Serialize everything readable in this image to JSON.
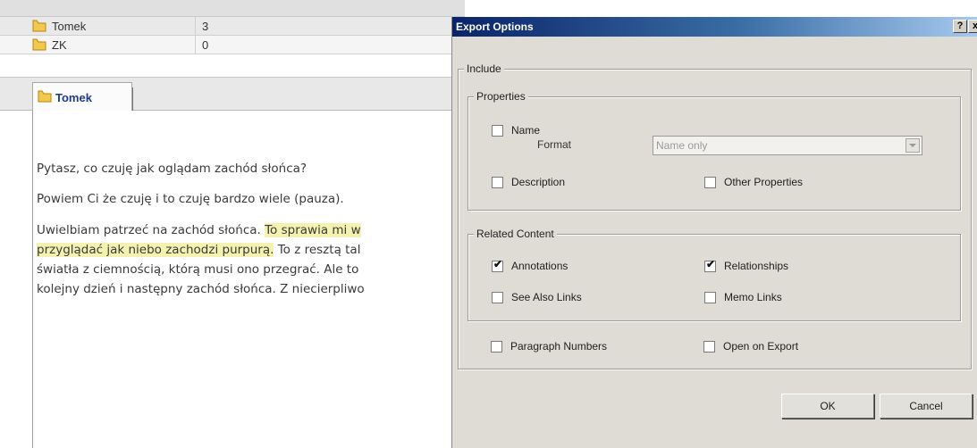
{
  "list": {
    "rows": [
      {
        "name": "Tomek",
        "count": "3"
      },
      {
        "name": "ZK",
        "count": "0"
      }
    ]
  },
  "tab": {
    "label": "Tomek"
  },
  "document": {
    "lines": [
      [
        {
          "text": "Pytasz, co czuję jak oglądam zachód słońca?",
          "highlight": false
        }
      ],
      [
        {
          "text": "Powiem Ci że czuję i to czuję bardzo wiele (pauza).",
          "highlight": false
        }
      ],
      [
        {
          "text": "Uwielbiam patrzeć na zachód słońca. ",
          "highlight": false
        },
        {
          "text": "To sprawia mi w",
          "highlight": true
        }
      ],
      [
        {
          "text": "przyglądać  jak niebo zachodzi purpurą.",
          "highlight": true
        },
        {
          "text": " To z resztą tal",
          "highlight": false
        }
      ],
      [
        {
          "text": "światła z ciemnością, którą musi ono przegrać.  Ale to",
          "highlight": false
        }
      ],
      [
        {
          "text": "kolejny dzień i następny zachód słońca. Z niecierpliwo",
          "highlight": false
        }
      ]
    ]
  },
  "dialog": {
    "title": "Export Options",
    "help_label": "?",
    "close_label": "x",
    "include": {
      "legend": "Include",
      "properties": {
        "legend": "Properties",
        "name_label": "Name",
        "name_checked": false,
        "format_label": "Format",
        "format_value": "Name only",
        "description_label": "Description",
        "description_checked": false,
        "other_properties_label": "Other Properties",
        "other_properties_checked": false
      },
      "related": {
        "legend": "Related Content",
        "annotations_label": "Annotations",
        "annotations_checked": true,
        "relationships_label": "Relationships",
        "relationships_checked": true,
        "see_also_label": "See Also Links",
        "see_also_checked": false,
        "memo_links_label": "Memo Links",
        "memo_links_checked": false
      },
      "paragraph_numbers_label": "Paragraph Numbers",
      "paragraph_numbers_checked": false,
      "open_on_export_label": "Open on Export",
      "open_on_export_checked": false
    },
    "ok_label": "OK",
    "cancel_label": "Cancel"
  },
  "colors": {
    "title_bar_start": "#0a246a",
    "title_bar_end": "#a6caf0",
    "highlight": "#f4f2b0",
    "folder_icon": "#f2c94c"
  }
}
